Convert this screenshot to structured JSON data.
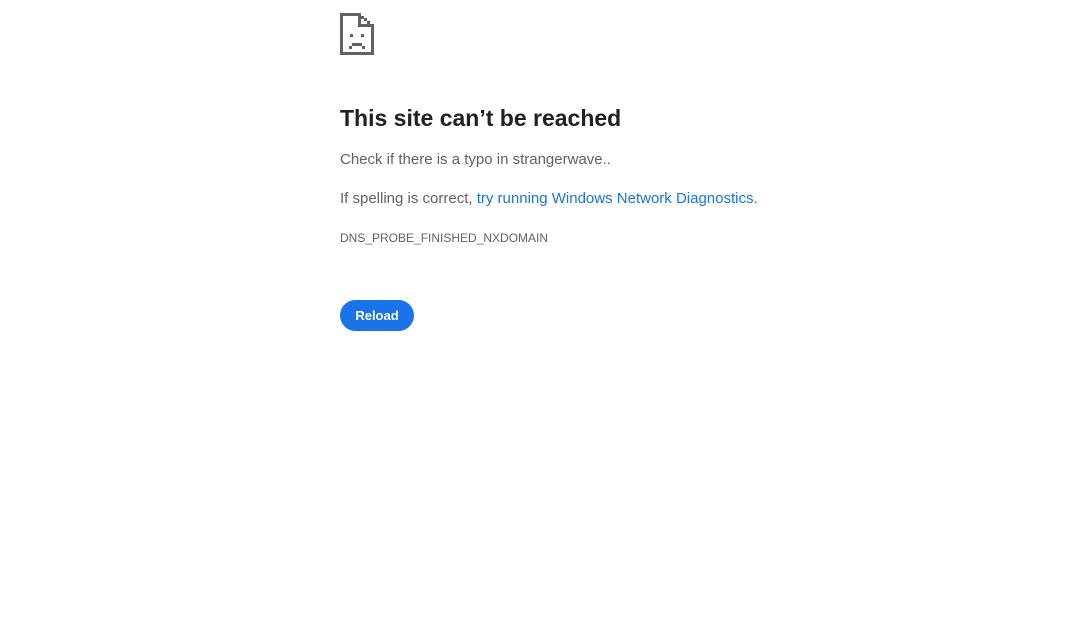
{
  "error_icon": "sad-document-icon",
  "heading": "This site can’t be reached",
  "typo_message": "Check if there is a typo in strangerwave..",
  "spelling_prefix": "If spelling is correct, ",
  "diagnostics_link": "try running Windows Network Diagnostics",
  "spelling_suffix": ".",
  "error_code": "DNS_PROBE_FINISHED_NXDOMAIN",
  "reload_label": "Reload",
  "colors": {
    "accent": "#1a73e8",
    "heading_text": "#202124",
    "body_text": "#5f6368",
    "icon": "#5f6368"
  }
}
